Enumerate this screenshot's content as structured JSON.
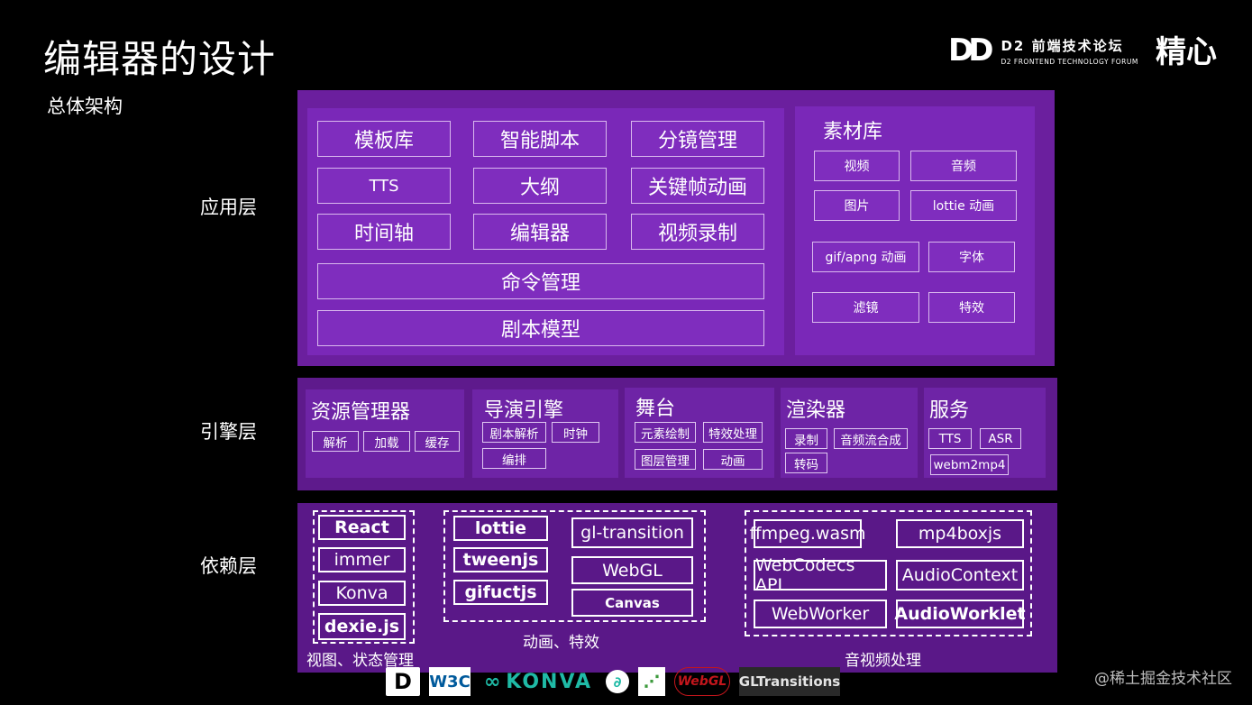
{
  "header": {
    "title": "编辑器的设计",
    "subtitle": "总体架构",
    "logo_mark": "DD",
    "logo_cn": "D2 前端技术论坛",
    "logo_en": "D2 FRONTEND TECHNOLOGY FORUM",
    "logo_jx": "精心"
  },
  "layers": {
    "app": "应用层",
    "engine": "引擎层",
    "deps": "依赖层"
  },
  "app": {
    "modules": [
      "模板库",
      "智能脚本",
      "分镜管理",
      "TTS",
      "大纲",
      "关键帧动画",
      "时间轴",
      "编辑器",
      "视频录制"
    ],
    "command": "命令管理",
    "script_model": "剧本模型",
    "material": {
      "title": "素材库",
      "items": [
        "视频",
        "音频",
        "图片",
        "lottie 动画",
        "gif/apng 动画",
        "字体",
        "滤镜",
        "特效"
      ]
    }
  },
  "engine": {
    "resource": {
      "title": "资源管理器",
      "tags": [
        "解析",
        "加载",
        "缓存"
      ]
    },
    "director": {
      "title": "导演引擎",
      "tags": [
        "剧本解析",
        "时钟",
        "编排"
      ]
    },
    "stage": {
      "title": "舞台",
      "tags": [
        "元素绘制",
        "特效处理",
        "图层管理",
        "动画"
      ]
    },
    "renderer": {
      "title": "渲染器",
      "tags": [
        "录制",
        "音频流合成",
        "转码"
      ]
    },
    "service": {
      "title": "服务",
      "tags": [
        "TTS",
        "ASR",
        "webm2mp4"
      ]
    }
  },
  "deps": {
    "view": {
      "caption": "视图、状态管理",
      "items": [
        "React",
        "immer",
        "Konva",
        "dexie.js"
      ]
    },
    "anim": {
      "caption": "动画、特效",
      "left": [
        "lottie",
        "tweenjs",
        "gifuctjs"
      ],
      "right": [
        "gl-transition",
        "WebGL",
        "Canvas"
      ]
    },
    "av": {
      "caption": "音视频处理",
      "items": [
        "ffmpeg.wasm",
        "mp4boxjs",
        "WebCodecs API",
        "AudioContext",
        "WebWorker",
        "AudioWorklet"
      ]
    }
  },
  "footer": {
    "logos": [
      "D",
      "W3C",
      "KONVA",
      "WebGL",
      "GLTransitions"
    ],
    "watermark": "@稀土掘金技术社区"
  }
}
